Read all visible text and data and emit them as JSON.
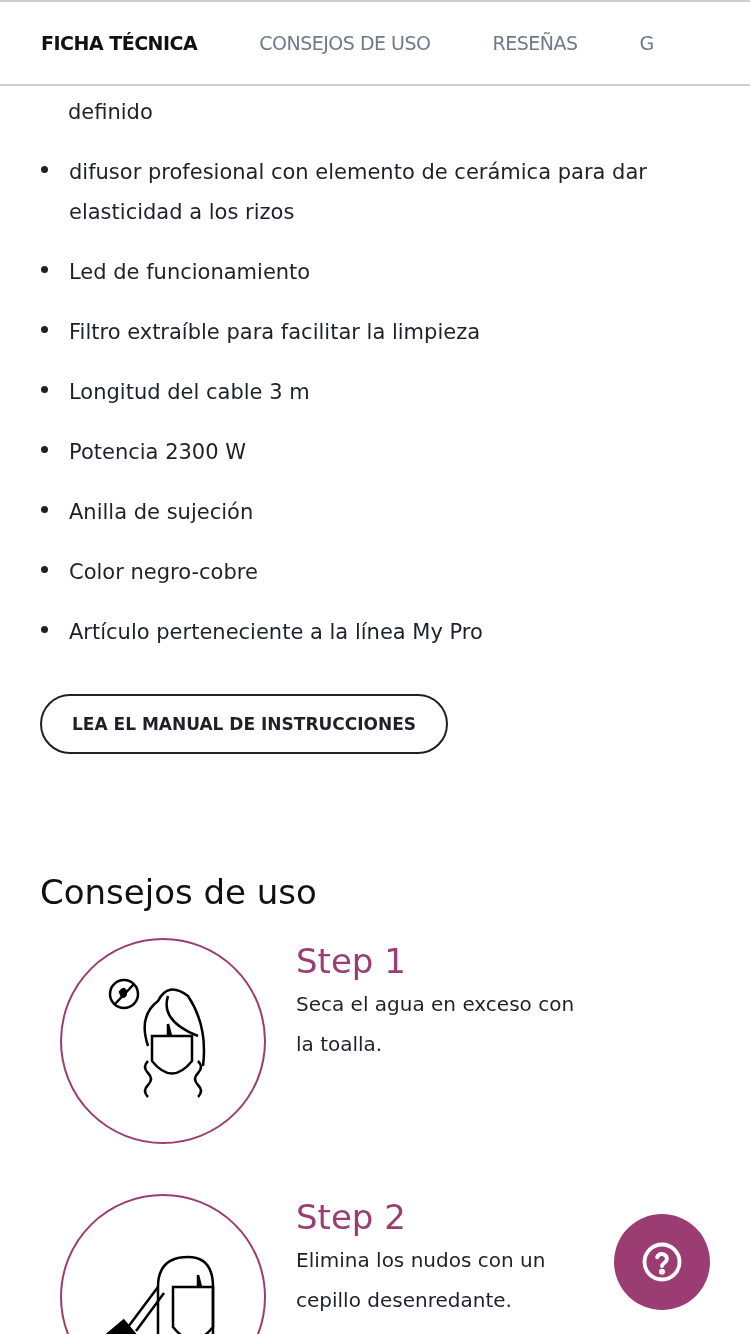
{
  "tabs": [
    {
      "label": "FICHA TÉCNICA",
      "selected": true
    },
    {
      "label": "CONSEJOS DE USO",
      "selected": false
    },
    {
      "label": "RESEÑAS",
      "selected": false
    },
    {
      "label": "G",
      "selected": false
    }
  ],
  "features": {
    "continuation": "definido",
    "items": [
      "difusor profesional con elemento de cerámica para dar elasticidad a los rizos",
      "Led de funcionamiento",
      "Filtro extraíble para facilitar la limpieza",
      "Longitud del cable 3 m",
      "Potencia 2300 W",
      "Anilla de sujeción",
      "Color negro-cobre",
      "Artículo perteneciente a la línea My Pro"
    ]
  },
  "manual_button": "LEA EL MANUAL DE INSTRUCCIONES",
  "tips": {
    "title": "Consejos de uso",
    "steps": [
      {
        "kind": "towel",
        "title": "Step 1",
        "text": "Seca el agua en exceso con la toalla."
      },
      {
        "kind": "brush",
        "title": "Step 2",
        "text": "Elimina los nudos con un cepillo desenredante."
      }
    ]
  }
}
